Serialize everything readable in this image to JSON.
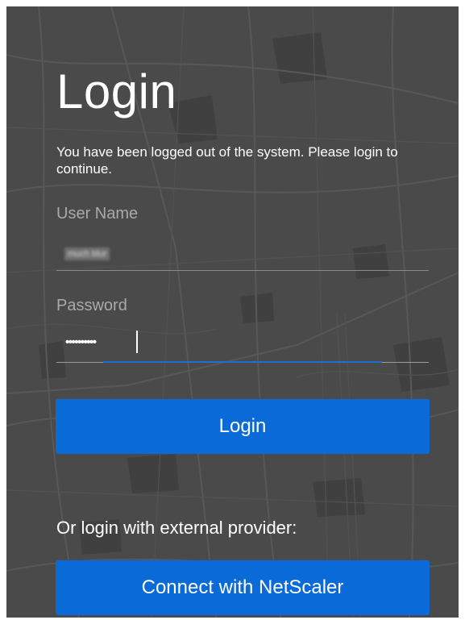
{
  "login": {
    "title": "Login",
    "notice": "You have been logged out of the system. Please login to continue.",
    "username_label": "User Name",
    "username_value": "much blur",
    "password_label": "Password",
    "password_value": "••••••••••",
    "login_button": "Login",
    "external_text": "Or login with external provider:",
    "external_button": "Connect with NetScaler"
  },
  "colors": {
    "background": "#4a4a4a",
    "accent": "#0a6ad8",
    "focus": "#1e6fd0",
    "label": "#a9a9a9"
  }
}
